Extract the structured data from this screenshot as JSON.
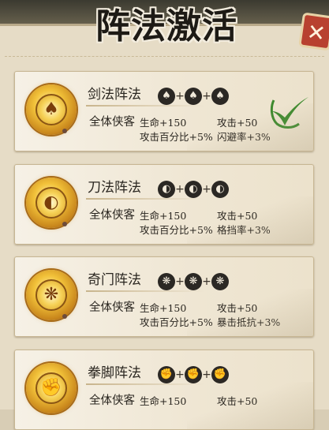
{
  "title": "阵法激活",
  "close_label": "✕",
  "formations": [
    {
      "name": "剑法阵法",
      "emblem_icon": "sword-emblem-icon",
      "emblem_glyph": "♠",
      "requirements": [
        {
          "icon": "sword-token-icon",
          "glyph": "♠"
        },
        {
          "icon": "sword-token-icon",
          "glyph": "♠"
        },
        {
          "icon": "sword-token-icon",
          "glyph": "♠"
        }
      ],
      "target": "全体侠客",
      "bonus_1": "生命+150",
      "bonus_2": "攻击+50",
      "bonus_3": "攻击百分比+5%",
      "bonus_4": "闪避率+3%",
      "activated": true
    },
    {
      "name": "刀法阵法",
      "emblem_icon": "blade-emblem-icon",
      "emblem_glyph": "◐",
      "requirements": [
        {
          "icon": "blade-token-icon",
          "glyph": "◐"
        },
        {
          "icon": "blade-token-icon",
          "glyph": "◐"
        },
        {
          "icon": "blade-token-icon",
          "glyph": "◐"
        }
      ],
      "target": "全体侠客",
      "bonus_1": "生命+150",
      "bonus_2": "攻击+50",
      "bonus_3": "攻击百分比+5%",
      "bonus_4": "格挡率+3%",
      "activated": false
    },
    {
      "name": "奇门阵法",
      "emblem_icon": "fan-emblem-icon",
      "emblem_glyph": "❋",
      "requirements": [
        {
          "icon": "fan-token-icon",
          "glyph": "❋"
        },
        {
          "icon": "fan-token-icon",
          "glyph": "❋"
        },
        {
          "icon": "fan-token-icon",
          "glyph": "❋"
        }
      ],
      "target": "全体侠客",
      "bonus_1": "生命+150",
      "bonus_2": "攻击+50",
      "bonus_3": "攻击百分比+5%",
      "bonus_4": "暴击抵抗+3%",
      "activated": false
    },
    {
      "name": "拳脚阵法",
      "emblem_icon": "fist-emblem-icon",
      "emblem_glyph": "✊",
      "requirements": [
        {
          "icon": "fist-token-icon",
          "glyph": "✊"
        },
        {
          "icon": "fist-token-icon",
          "glyph": "✊"
        },
        {
          "icon": "fist-token-icon",
          "glyph": "✊"
        }
      ],
      "target": "全体侠客",
      "bonus_1": "生命+150",
      "bonus_2": "攻击+50",
      "activated": false
    }
  ],
  "colors": {
    "check_green": "#3e8a2e",
    "close_red": "#b8412f",
    "emblem_gold": "#f2c23a"
  }
}
